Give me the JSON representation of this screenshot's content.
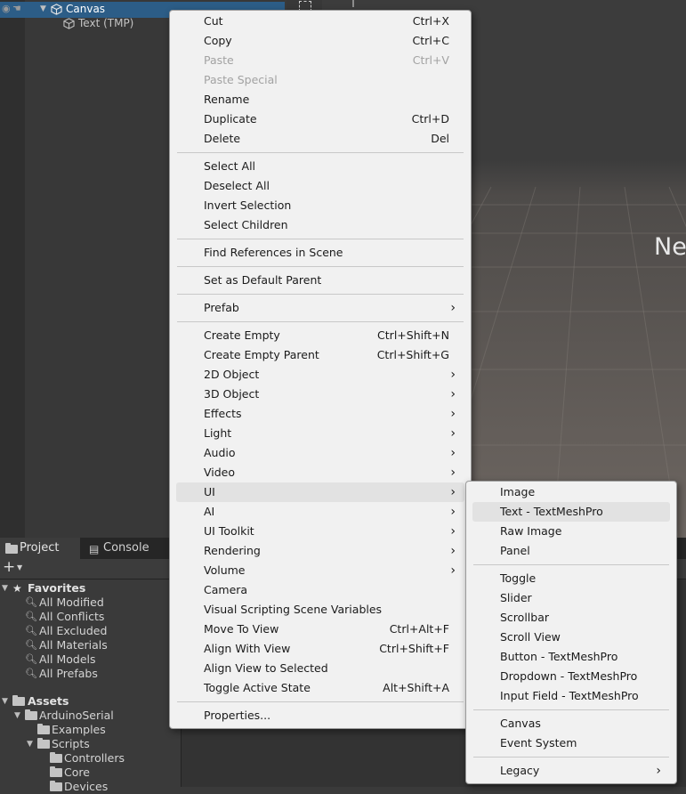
{
  "hierarchy": {
    "items": [
      {
        "label": "Canvas",
        "selected": true
      },
      {
        "label": "Text (TMP)",
        "selected": false
      }
    ]
  },
  "scene": {
    "overlay_text": "Ne"
  },
  "project_panel": {
    "tabs": [
      "Project",
      "Console"
    ],
    "add_label": "+",
    "favorites": {
      "label": "Favorites",
      "items": [
        "All Modified",
        "All Conflicts",
        "All Excluded",
        "All Materials",
        "All Models",
        "All Prefabs"
      ]
    },
    "assets": {
      "label": "Assets",
      "tree": [
        {
          "label": "ArduinoSerial",
          "depth": 1
        },
        {
          "label": "Examples",
          "depth": 2
        },
        {
          "label": "Scripts",
          "depth": 2
        },
        {
          "label": "Controllers",
          "depth": 3
        },
        {
          "label": "Core",
          "depth": 3
        },
        {
          "label": "Devices",
          "depth": 3
        }
      ]
    }
  },
  "context_menu": {
    "items": [
      {
        "label": "Cut",
        "shortcut": "Ctrl+X"
      },
      {
        "label": "Copy",
        "shortcut": "Ctrl+C"
      },
      {
        "label": "Paste",
        "shortcut": "Ctrl+V",
        "disabled": true
      },
      {
        "label": "Paste Special",
        "shortcut": "",
        "disabled": true
      },
      {
        "label": "Rename",
        "shortcut": ""
      },
      {
        "label": "Duplicate",
        "shortcut": "Ctrl+D"
      },
      {
        "label": "Delete",
        "shortcut": "Del"
      },
      {
        "separator": true
      },
      {
        "label": "Select All",
        "shortcut": ""
      },
      {
        "label": "Deselect All",
        "shortcut": ""
      },
      {
        "label": "Invert Selection",
        "shortcut": ""
      },
      {
        "label": "Select Children",
        "shortcut": ""
      },
      {
        "separator": true
      },
      {
        "label": "Find References in Scene",
        "shortcut": ""
      },
      {
        "separator": true
      },
      {
        "label": "Set as Default Parent",
        "shortcut": ""
      },
      {
        "separator": true
      },
      {
        "label": "Prefab",
        "shortcut": "",
        "submenu": true
      },
      {
        "separator": true
      },
      {
        "label": "Create Empty",
        "shortcut": "Ctrl+Shift+N"
      },
      {
        "label": "Create Empty Parent",
        "shortcut": "Ctrl+Shift+G"
      },
      {
        "label": "2D Object",
        "shortcut": "",
        "submenu": true
      },
      {
        "label": "3D Object",
        "shortcut": "",
        "submenu": true
      },
      {
        "label": "Effects",
        "shortcut": "",
        "submenu": true
      },
      {
        "label": "Light",
        "shortcut": "",
        "submenu": true
      },
      {
        "label": "Audio",
        "shortcut": "",
        "submenu": true
      },
      {
        "label": "Video",
        "shortcut": "",
        "submenu": true
      },
      {
        "label": "UI",
        "shortcut": "",
        "submenu": true,
        "highlighted": true
      },
      {
        "label": "AI",
        "shortcut": "",
        "submenu": true
      },
      {
        "label": "UI Toolkit",
        "shortcut": "",
        "submenu": true
      },
      {
        "label": "Rendering",
        "shortcut": "",
        "submenu": true
      },
      {
        "label": "Volume",
        "shortcut": "",
        "submenu": true
      },
      {
        "label": "Camera",
        "shortcut": ""
      },
      {
        "label": "Visual Scripting Scene Variables",
        "shortcut": ""
      },
      {
        "label": "Move To View",
        "shortcut": "Ctrl+Alt+F"
      },
      {
        "label": "Align With View",
        "shortcut": "Ctrl+Shift+F"
      },
      {
        "label": "Align View to Selected",
        "shortcut": ""
      },
      {
        "label": "Toggle Active State",
        "shortcut": "Alt+Shift+A"
      },
      {
        "separator": true
      },
      {
        "label": "Properties...",
        "shortcut": ""
      }
    ]
  },
  "ui_submenu": {
    "items": [
      {
        "label": "Image"
      },
      {
        "label": "Text - TextMeshPro",
        "highlighted": true
      },
      {
        "label": "Raw Image"
      },
      {
        "label": "Panel"
      },
      {
        "separator": true
      },
      {
        "label": "Toggle"
      },
      {
        "label": "Slider"
      },
      {
        "label": "Scrollbar"
      },
      {
        "label": "Scroll View"
      },
      {
        "label": "Button - TextMeshPro"
      },
      {
        "label": "Dropdown - TextMeshPro"
      },
      {
        "label": "Input Field - TextMeshPro"
      },
      {
        "separator": true
      },
      {
        "label": "Canvas"
      },
      {
        "label": "Event System"
      },
      {
        "separator": true
      },
      {
        "label": "Legacy",
        "submenu": true
      }
    ]
  }
}
